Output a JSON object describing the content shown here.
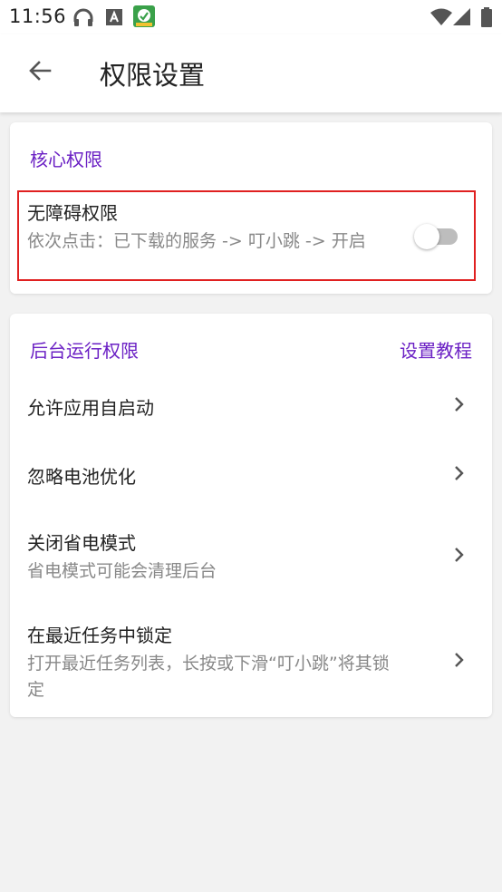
{
  "status": {
    "time": "11:56"
  },
  "header": {
    "title": "权限设置"
  },
  "core": {
    "section_title": "核心权限",
    "item": {
      "title": "无障碍权限",
      "subtitle": "依次点击：已下载的服务 -> 叮小跳 -> 开启",
      "toggle_on": false
    }
  },
  "background": {
    "section_title": "后台运行权限",
    "tutorial_link": "设置教程",
    "items": [
      {
        "title": "允许应用自启动",
        "subtitle": ""
      },
      {
        "title": "忽略电池优化",
        "subtitle": ""
      },
      {
        "title": "关闭省电模式",
        "subtitle": "省电模式可能会清理后台"
      },
      {
        "title": "在最近任务中锁定",
        "subtitle": "打开最近任务列表，长按或下滑“叮小跳”将其锁定"
      }
    ]
  },
  "colors": {
    "accent": "#6a1fc4",
    "highlight": "#e02020"
  }
}
